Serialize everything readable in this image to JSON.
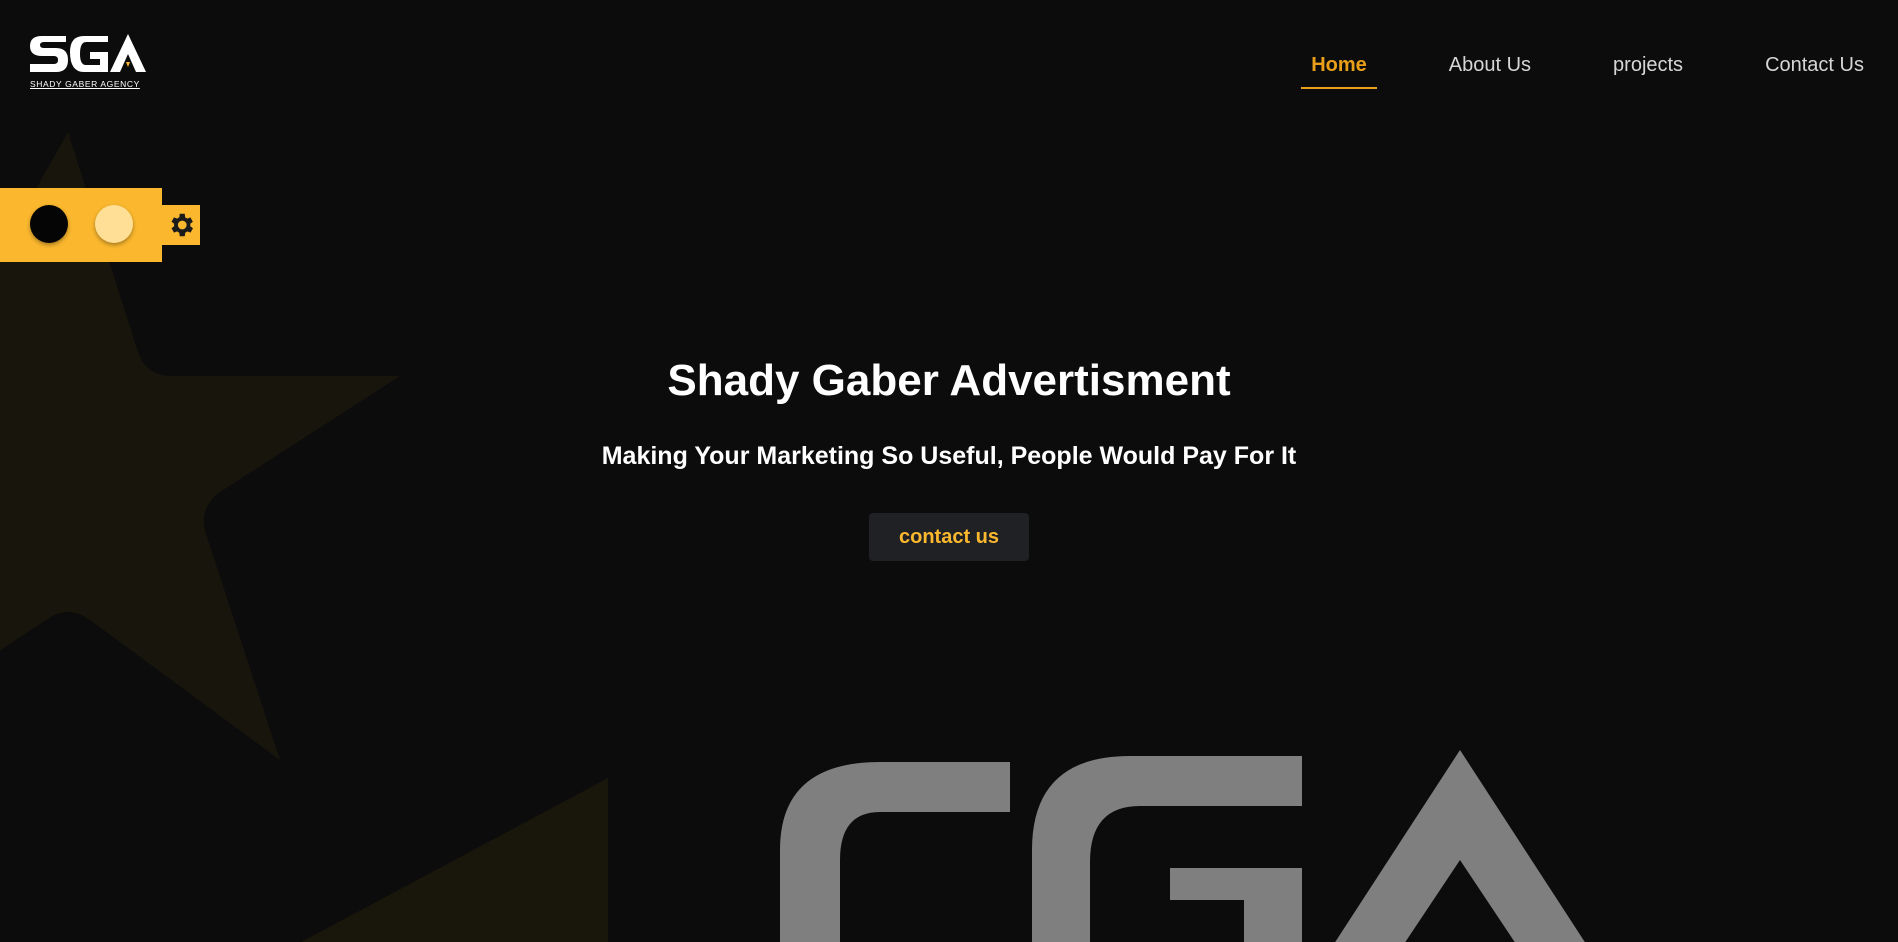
{
  "header": {
    "logo_text": "SGA",
    "logo_caption": "SHADY GABER AGENCY",
    "nav": [
      {
        "label": "Home",
        "active": true
      },
      {
        "label": "About Us",
        "active": false
      },
      {
        "label": "projects",
        "active": false
      },
      {
        "label": "Contact Us",
        "active": false
      }
    ]
  },
  "theme_switcher": {
    "options": [
      "dark-theme",
      "light-theme"
    ],
    "icon": "gear-icon"
  },
  "hero": {
    "title": "Shady Gaber Advertisment",
    "subtitle": "Making Your Marketing So Useful, People Would Pay For It",
    "cta_label": "contact us"
  },
  "colors": {
    "background": "#0c0c0c",
    "accent": "#fbb82e",
    "nav_active": "#e9a018",
    "text": "#ffffff",
    "button_bg": "#1f2125"
  }
}
